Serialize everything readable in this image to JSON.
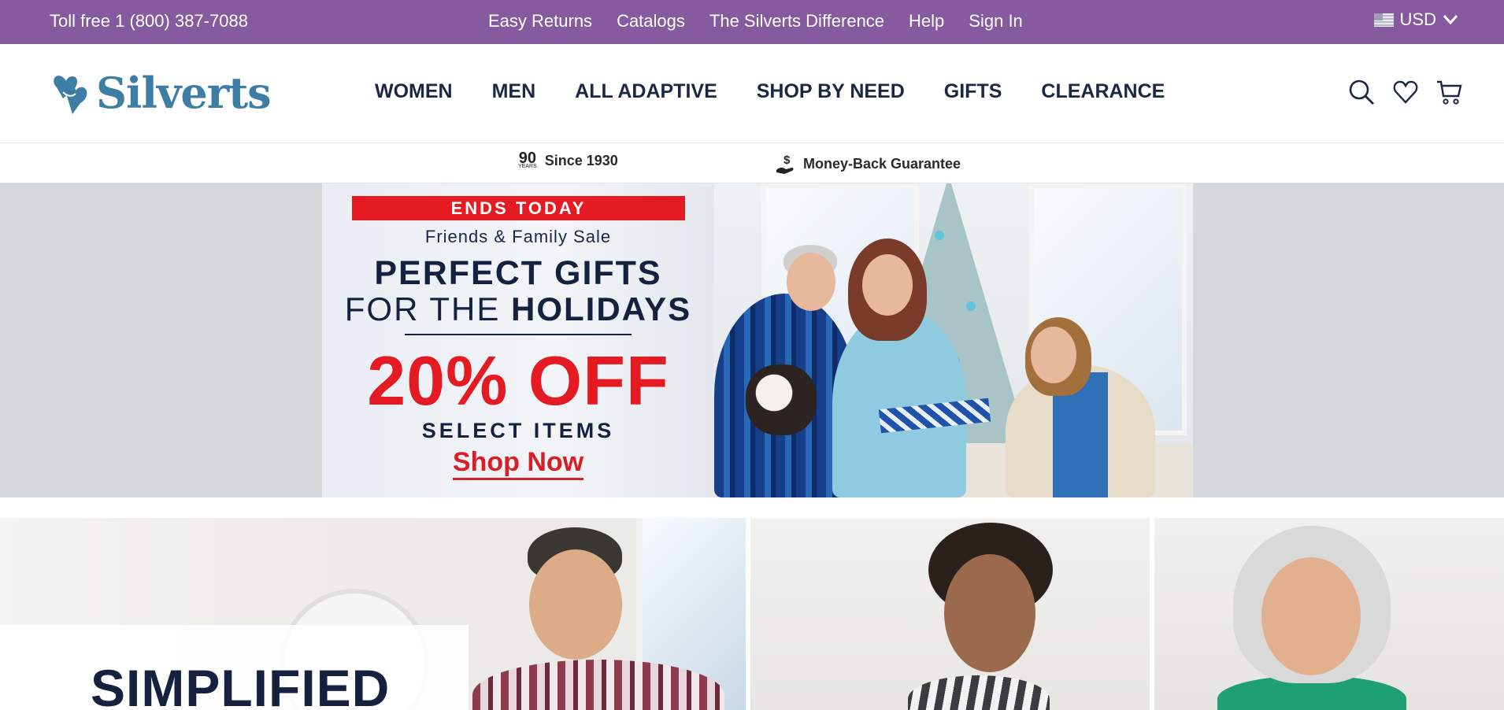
{
  "utility_bar": {
    "phone": "Toll free 1 (800) 387-7088",
    "links": [
      "Easy Returns",
      "Catalogs",
      "The Silverts Difference",
      "Help",
      "Sign In"
    ],
    "currency": "USD"
  },
  "header": {
    "logo_text": "Silverts",
    "nav": [
      "WOMEN",
      "MEN",
      "ALL ADAPTIVE",
      "SHOP BY NEED",
      "GIFTS",
      "CLEARANCE"
    ]
  },
  "trust_strip": {
    "years_number": "90",
    "years_label": "YEARS",
    "since": "Since 1930",
    "guarantee": "Money-Back Guarantee"
  },
  "hero": {
    "badge": "ENDS TODAY",
    "subtitle": "Friends & Family Sale",
    "title_line1": "PERFECT GIFTS",
    "title_line2_prefix": "FOR THE",
    "title_line2_bold": "HOLIDAYS",
    "discount": "20% OFF",
    "select_items": "SELECT ITEMS",
    "cta": "Shop Now"
  },
  "tiles": {
    "tile1_title": "SIMPLIFIED"
  },
  "colors": {
    "utility_bar_bg": "#855a9e",
    "brand_blue": "#3e7da4",
    "navy": "#1c2746",
    "sale_red": "#e51b23"
  }
}
